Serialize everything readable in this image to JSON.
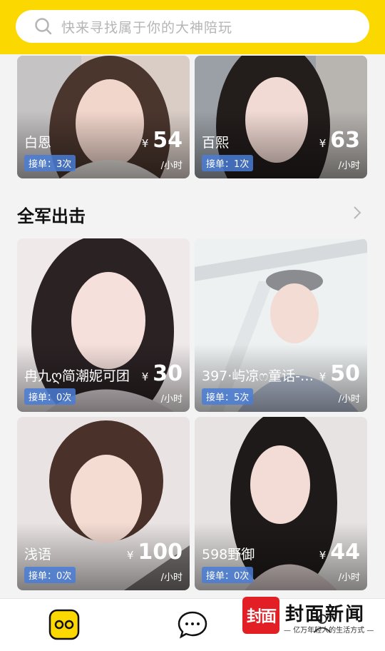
{
  "search": {
    "placeholder": "快来寻找属于你的大神陪玩"
  },
  "section": {
    "title": "全军出击"
  },
  "top_cards": [
    {
      "name": "白恩",
      "orders": "接单：3次",
      "yen": "¥",
      "price": "54",
      "unit": "/小时"
    },
    {
      "name": "百熙",
      "orders": "接单：1次",
      "yen": "¥",
      "price": "63",
      "unit": "/小时"
    }
  ],
  "cards": [
    {
      "name": "冉九ღ简潮妮可团",
      "orders": "接单：0次",
      "yen": "¥",
      "price": "30",
      "unit": "/小时"
    },
    {
      "name": "397·屿凉ෆ童话-童...",
      "orders": "接单：5次",
      "yen": "¥",
      "price": "50",
      "unit": "/小时"
    },
    {
      "name": "浅语",
      "orders": "接单：0次",
      "yen": "¥",
      "price": "100",
      "unit": "/小时"
    },
    {
      "name": "598野御",
      "orders": "接单：0次",
      "yen": "¥",
      "price": "44",
      "unit": "/小时"
    }
  ],
  "tabbar": {
    "icons": [
      "home-face-icon",
      "chat-bubble-icon",
      "profile-icon"
    ]
  },
  "watermark": {
    "logo": "封面",
    "text": "封面新闻",
    "slogan": "— 亿万年轻人的生活方式 —"
  },
  "colors": {
    "accent": "#fbd800",
    "badge": "#4a7cd6",
    "watermark_red": "#e31f26"
  }
}
